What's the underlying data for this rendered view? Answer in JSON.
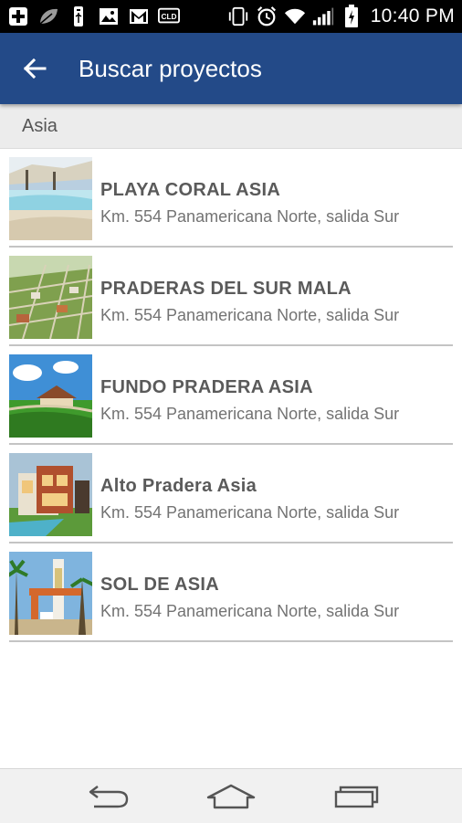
{
  "status_bar": {
    "time": "10:40 PM",
    "left_icons": [
      "plus-box-icon",
      "leaf-icon",
      "usb-icon",
      "image-icon",
      "gmail-icon",
      "cld-icon"
    ],
    "right_icons": [
      "vibrate-icon",
      "alarm-icon",
      "wifi-icon",
      "signal-icon",
      "battery-icon"
    ],
    "cld_label": "CLD"
  },
  "app_bar": {
    "title": "Buscar proyectos",
    "color": "#234a88"
  },
  "section": {
    "label": "Asia"
  },
  "projects": [
    {
      "name": "PLAYA CORAL ASIA",
      "address": "Km. 554 Panamericana Norte, salida Sur",
      "thumbnail": "beach-pool"
    },
    {
      "name": "PRADERAS DEL SUR MALA",
      "address": "Km. 554 Panamericana Norte, salida Sur",
      "thumbnail": "aerial-plots"
    },
    {
      "name": "FUNDO PRADERA ASIA",
      "address": "Km. 554 Panamericana Norte, salida Sur",
      "thumbnail": "green-field-house"
    },
    {
      "name": "Alto Pradera Asia",
      "address": "Km. 554 Panamericana Norte, salida Sur",
      "thumbnail": "modern-house"
    },
    {
      "name": "SOL DE ASIA",
      "address": "Km. 554 Panamericana Norte, salida Sur",
      "thumbnail": "entrance-gate"
    }
  ],
  "nav_bar": {
    "icons": [
      "back-nav-icon",
      "home-nav-icon",
      "recent-apps-icon"
    ]
  }
}
